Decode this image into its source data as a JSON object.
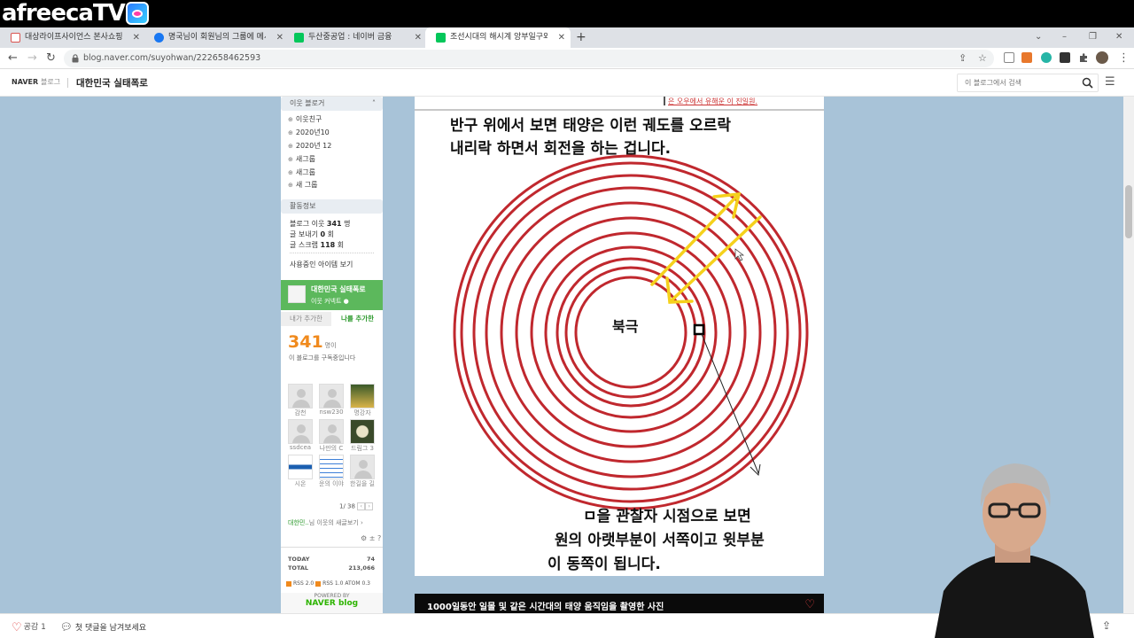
{
  "streaming_overlay": {
    "logo_text": "afreecaTV"
  },
  "browser": {
    "tabs": [
      {
        "title": "대상라이프사이언스 본사쇼핑몰",
        "favicon_color": "#d9534f",
        "active": false
      },
      {
        "title": "명국님이 회원님의 그룹에 메시지를",
        "favicon_color": "#1877f2",
        "active": false
      },
      {
        "title": "두산중공업 : 네이버 금융",
        "favicon_color": "#03c75a",
        "active": false
      },
      {
        "title": "조선시대의 해시계 앙부일구와 ...",
        "favicon_color": "#03c75a",
        "active": true
      }
    ],
    "new_tab": "+",
    "url": "blog.naver.com/suyohwan/222658462593",
    "window_controls": {
      "down": "⌄",
      "minimize": "–",
      "restore": "❐",
      "close": "✕"
    }
  },
  "blog": {
    "brand_naver": "NAVER",
    "brand_blog": "블로그",
    "title": "대한민국 실태폭로",
    "search_placeholder": "이 블로그에서 검색",
    "sidebar": {
      "neighbors_header": "이웃 블로거",
      "neighbor_groups": [
        "이웃친구",
        "2020년10",
        "2020년 12",
        "새그룹",
        "새그룹",
        "새 그룹"
      ],
      "activity_header": "활동정보",
      "activity": {
        "neighbors_label": "블로그 이웃",
        "neighbors_value": "341",
        "neighbors_unit": "명",
        "sent_label": "글 보내기",
        "sent_value": "0",
        "sent_unit": "회",
        "scrap_label": "글 스크랩",
        "scrap_value": "118",
        "scrap_unit": "회"
      },
      "items_link": "사용중인 아이템 보기",
      "neighbor_card": {
        "name": "대한민국 실태폭로",
        "sub": "이웃 커넥트"
      },
      "tab_added_me": "내가 추가한",
      "tab_added_by": "나를 추가한",
      "count": "341",
      "count_unit": "명이",
      "count_sub": "이 블로그를 구독중입니다",
      "avatars": [
        {
          "label": "감천"
        },
        {
          "label": "nsw230"
        },
        {
          "label": "명강자"
        },
        {
          "label": "ssdcea"
        },
        {
          "label": "나만의 C"
        },
        {
          "label": "드림그 3"
        },
        {
          "label": "시온"
        },
        {
          "label": "운의 이야"
        },
        {
          "label": "한길을 길"
        }
      ],
      "pager": "1/ 38",
      "note_user": "대한민..",
      "note_text": "님 이웃의 새글보기 ›",
      "tools": "⚙ ± ?",
      "today_label": "TODAY",
      "today_value": "74",
      "total_label": "TOTAL",
      "total_value": "213,066",
      "rss": [
        "RSS 2.0",
        "RSS 1.0",
        "ATOM 0.3"
      ],
      "powered_by": "POWERED BY",
      "powered_brand": "NAVER blog"
    },
    "post": {
      "top_snippet": "은 오우에서 유해운 이 진일원.",
      "caption_line1": "반구 위에서 보면 태양은 이런 궤도를 오르락",
      "caption_line2": "내리락 하면서 회전을 하는 겁니다.",
      "center_label": "북극",
      "bottom_line1": "ㅁ을 관찰자 시점으로 보면",
      "bottom_line2": "원의 아랫부분이 서쪽이고 윗부분",
      "bottom_line3": "이 동쪽이 됩니다.",
      "next_banner": "1000일동안 일몰 및 같은 시간대의 태양 움직임을 촬영한 사진",
      "circle_color": "#c0282e",
      "arrow_color": "#f5d11c"
    },
    "footer": {
      "like_label": "공감",
      "like_count": "1",
      "comment_label": "첫 댓글을 남겨보세요"
    }
  }
}
